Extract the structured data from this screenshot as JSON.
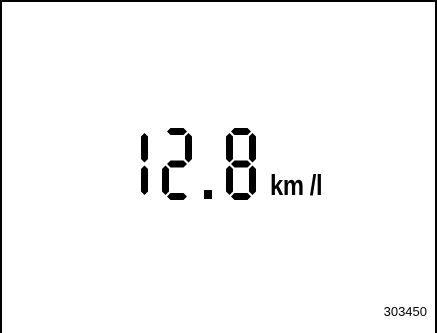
{
  "display": {
    "value": "12.8",
    "unit": "km /l",
    "segment_color": "#000000"
  },
  "figure_id": "303450"
}
